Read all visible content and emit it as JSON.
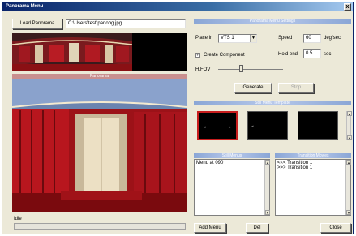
{
  "window": {
    "title": "Panorama Menu",
    "close_glyph": "x"
  },
  "left": {
    "load_button": "Load Panorama",
    "file_path": "C:\\Users\\test\\panobg.jpg",
    "preview_header": "Panorama",
    "status": "Idle"
  },
  "settings": {
    "header": "Panorama Menu Settings",
    "place_in_label": "Place in",
    "place_in_value": "VTS 1",
    "speed_label": "Speed",
    "speed_value": "60",
    "speed_unit": "deg/sec",
    "create_component_label": "Create Component",
    "create_component_checked": true,
    "hold_end_label": "Hold end",
    "hold_end_value": "0.5",
    "hold_end_unit": "sec",
    "hfov_label": "H.FOV",
    "hfov_level": 0.35,
    "generate_button": "Generate",
    "stop_button": "Stop"
  },
  "templates": {
    "header": "Still Menu Template"
  },
  "still_menus": {
    "header": "Still Menus",
    "items": [
      "Menu at 090"
    ]
  },
  "transition_movies": {
    "header": "Transition Movies",
    "items": [
      "<<< Transition 1",
      ">>> Transition 1"
    ]
  },
  "footer": {
    "add_button": "Add Menu",
    "del_button": "Del",
    "close_button": "Close"
  },
  "colors": {
    "title_bar": "#0a246a",
    "section_header": "#8aa6d6",
    "pano_header": "#c98f8f",
    "selected_template": "#c81e1e"
  }
}
